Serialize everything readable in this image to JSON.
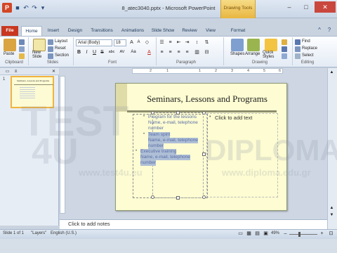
{
  "window": {
    "title": "8_atec3040.pptx - Microsoft PowerPoint",
    "context_tab_group": "Drawing Tools",
    "app_icon": "P"
  },
  "tabs": {
    "file": "File",
    "home": "Home",
    "insert": "Insert",
    "design": "Design",
    "transitions": "Transitions",
    "animations": "Animations",
    "slideshow": "Slide Show",
    "review": "Review",
    "view": "View",
    "format": "Format"
  },
  "ribbon": {
    "clipboard": {
      "label": "Clipboard",
      "paste": "Paste"
    },
    "slides": {
      "label": "Slides",
      "new_slide": "New Slide",
      "layout": "Layout",
      "reset": "Reset",
      "section": "Section"
    },
    "font": {
      "label": "Font",
      "font_name": "Arial (Body)",
      "font_size": "18",
      "bold": "B",
      "italic": "I",
      "underline": "U",
      "strike": "S",
      "shadow": "abc",
      "spacing": "AV",
      "case": "Aa",
      "color": "A"
    },
    "paragraph": {
      "label": "Paragraph"
    },
    "drawing": {
      "label": "Drawing",
      "shapes": "Shapes",
      "arrange": "Arrange",
      "quick_styles": "Quick Styles"
    },
    "editing": {
      "label": "Editing",
      "find": "Find",
      "replace": "Replace",
      "select": "Select"
    }
  },
  "ruler": {
    "top_numbers": [
      "2",
      "1",
      "1",
      "2",
      "3",
      "4",
      "5",
      "6"
    ]
  },
  "left_pane": {
    "slide_number": "1",
    "thumb_title": "Seminars, Lessons and Programs"
  },
  "slide": {
    "title": "Seminars, Lessons and Programs",
    "left_items": [
      {
        "text": "Program for the lessons"
      },
      {
        "text": "Name, e-mail, telephone"
      },
      {
        "text": "number"
      },
      {
        "text": "Team spirit"
      },
      {
        "text": "Name, e-mail, telephone"
      },
      {
        "text": "number"
      },
      {
        "text": "Executive training"
      },
      {
        "text": "Name, e-mail, telephone"
      },
      {
        "text": "number"
      }
    ],
    "right_placeholder": "Click to add text"
  },
  "notes": {
    "placeholder": "Click to add notes"
  },
  "status": {
    "slide": "Slide 1 of 1",
    "theme": "\"Layers\"",
    "language": "English (U.S.)",
    "zoom": "49%"
  },
  "watermark": {
    "line1": "TEST",
    "line2": "4U",
    "line3": "DIPLOMA",
    "url1": "www.test4u.eu",
    "url2": "www.diploma.edu.gr"
  },
  "colors": {
    "file_tab": "#c8371f",
    "selection": "#aebfd6",
    "slide_bg": "#fdfcd2",
    "context_tab": "#f6dc86"
  }
}
